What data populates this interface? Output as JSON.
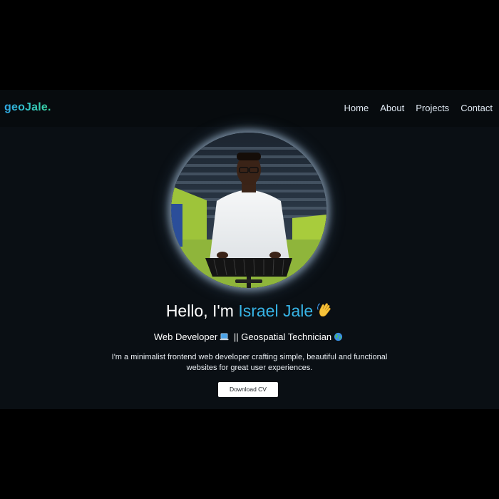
{
  "navbar": {
    "logo": "geoJale.",
    "links": [
      "Home",
      "About",
      "Projects",
      "Contact"
    ]
  },
  "hero": {
    "greeting_prefix": "Hello, I'm ",
    "name": "Israel Jale",
    "role_1": "Web Developer",
    "separator": " || ",
    "role_2": "Geospatial Technician",
    "bio": "I'm a minimalist frontend web developer crafting simple, beautiful and functional websites for great user experiences.",
    "download_label": "Download CV"
  },
  "icons": {
    "greeting": "waving-hand-icon",
    "role_1": "laptop-icon",
    "role_2": "globe-icon"
  },
  "colors": {
    "accent": "#37b4e6",
    "logo_gradient": [
      "#2fa7e6",
      "#3ad6a2"
    ],
    "background": "#0a0f14",
    "navbar": "#070b0e"
  }
}
